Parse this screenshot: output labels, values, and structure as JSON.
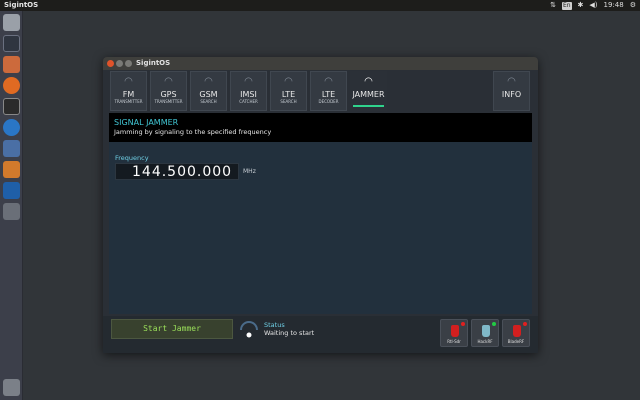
{
  "topbar": {
    "title": "SigintOS",
    "keyboard": "En",
    "clock": "19:48"
  },
  "window": {
    "title": "SigintOS"
  },
  "tabs": [
    {
      "name": "FM",
      "sub": "TRANSMITTER",
      "active": false
    },
    {
      "name": "GPS",
      "sub": "TRANSMITTER",
      "active": false
    },
    {
      "name": "GSM",
      "sub": "SEARCH",
      "active": false
    },
    {
      "name": "IMSI",
      "sub": "CATCHER",
      "active": false
    },
    {
      "name": "LTE",
      "sub": "SEARCH",
      "active": false
    },
    {
      "name": "LTE",
      "sub": "DECODER",
      "active": false
    },
    {
      "name": "JAMMER",
      "sub": "",
      "active": true
    }
  ],
  "info_tab": {
    "name": "INFO"
  },
  "header": {
    "title": "SIGNAL JAMMER",
    "description": "Jamming by signaling to the specified frequency"
  },
  "frequency": {
    "label": "Frequency",
    "value": "144.500.000",
    "unit": "MHz"
  },
  "controls": {
    "start_label": "Start Jammer"
  },
  "status": {
    "label": "Status",
    "value": "Waiting to start"
  },
  "devices": [
    {
      "name": "Rtl-Sdr",
      "led_color": "#e02020",
      "body_color": "#d21f1f"
    },
    {
      "name": "HackRF",
      "led_color": "#22cc44",
      "body_color": "#7fb8c8"
    },
    {
      "name": "BladeRF",
      "led_color": "#e02020",
      "body_color": "#d21f1f"
    }
  ],
  "colors": {
    "accent": "#2fd38c",
    "cyan": "#41c6d4",
    "start_text": "#9be05a"
  }
}
